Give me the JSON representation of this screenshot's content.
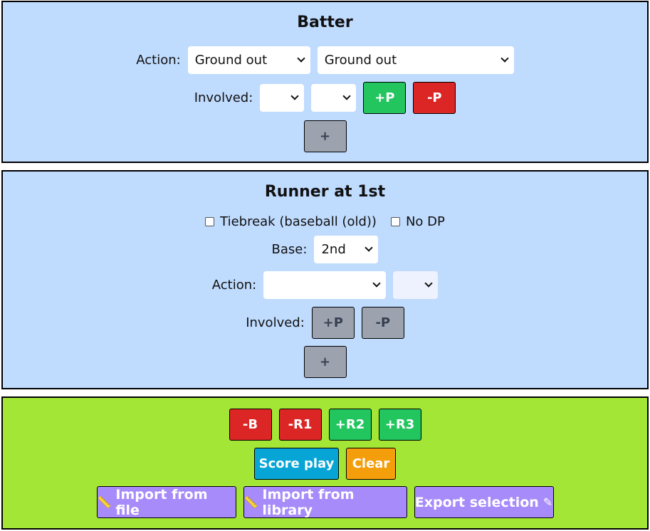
{
  "batter": {
    "title": "Batter",
    "action_label": "Action:",
    "action_select_1": "Ground out",
    "action_select_2": "Ground out",
    "involved_label": "Involved:",
    "involved_select_1": "",
    "involved_select_2": "",
    "add_player_button": "+P",
    "remove_player_button": "-P",
    "add_button": "+"
  },
  "runner": {
    "title": "Runner at 1st",
    "tiebreak_label": "Tiebreak (baseball (old))",
    "no_dp_label": "No DP",
    "base_label": "Base:",
    "base_select": "2nd",
    "action_label": "Action:",
    "action_select_1": "",
    "action_select_2": "",
    "involved_label": "Involved:",
    "add_player_button": "+P",
    "remove_player_button": "-P",
    "add_button": "+"
  },
  "actions": {
    "remove_batter": "-B",
    "remove_r1": "-R1",
    "add_r2": "+R2",
    "add_r3": "+R3",
    "score_play": "Score play",
    "clear": "Clear",
    "import_file": "Import from file",
    "import_library": "Import from library",
    "export_selection": "Export selection"
  },
  "colors": {
    "panel_blue": "#bfdbfe",
    "panel_green": "#a3e635",
    "button_green": "#22c55e",
    "button_red": "#dc2626",
    "button_gray": "#9ca3af",
    "button_blue": "#06a5d6",
    "button_orange": "#f59e0b",
    "button_purple": "#a78bfa"
  },
  "icons": {
    "import_icon": "import-icon",
    "export_icon": "export-icon"
  }
}
